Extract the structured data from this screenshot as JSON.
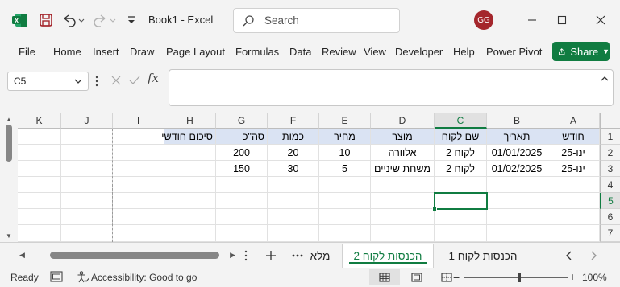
{
  "title": {
    "doc": "Book1",
    "app": "Excel",
    "full": "Book1  -  Excel"
  },
  "search": {
    "placeholder": "Search"
  },
  "user": {
    "initials": "GG"
  },
  "menu": [
    "File",
    "Home",
    "Insert",
    "Draw",
    "Page Layout",
    "Formulas",
    "Data",
    "Review",
    "View",
    "Developer",
    "Help",
    "Power Pivot"
  ],
  "share": {
    "label": "Share"
  },
  "namebox": {
    "value": "C5"
  },
  "formula": {
    "value": ""
  },
  "columns": [
    "K",
    "J",
    "I",
    "H",
    "G",
    "F",
    "E",
    "D",
    "C",
    "B",
    "A"
  ],
  "rows": [
    "1",
    "2",
    "3",
    "4",
    "5",
    "6",
    "7"
  ],
  "sheet": {
    "header": {
      "A": "חודש",
      "B": "תאריך",
      "C": "שם לקוח",
      "D": "מוצר",
      "E": "מחיר",
      "F": "כמות",
      "G": "סה\"כ",
      "H": "סיכום חודשי"
    },
    "row2": {
      "A": "ינו-25",
      "B": "01/01/2025",
      "C": "לקוח 2",
      "D": "אלוורה",
      "E": "10",
      "F": "20",
      "G": "200"
    },
    "row3": {
      "A": "ינו-25",
      "B": "01/02/2025",
      "C": "לקוח 2",
      "D": "משחת שיניים",
      "E": "5",
      "F": "30",
      "G": "150"
    }
  },
  "tabs": {
    "extra": "מלא",
    "active": "הכנסות לקוח 2",
    "other": "הכנסות לקוח 1"
  },
  "status": {
    "ready": "Ready",
    "accessibility": "Accessibility: Good to go",
    "zoom": "100%"
  },
  "colors": {
    "accent": "#107c41",
    "header_fill": "#dae3f3",
    "avatar": "#a4262c"
  }
}
